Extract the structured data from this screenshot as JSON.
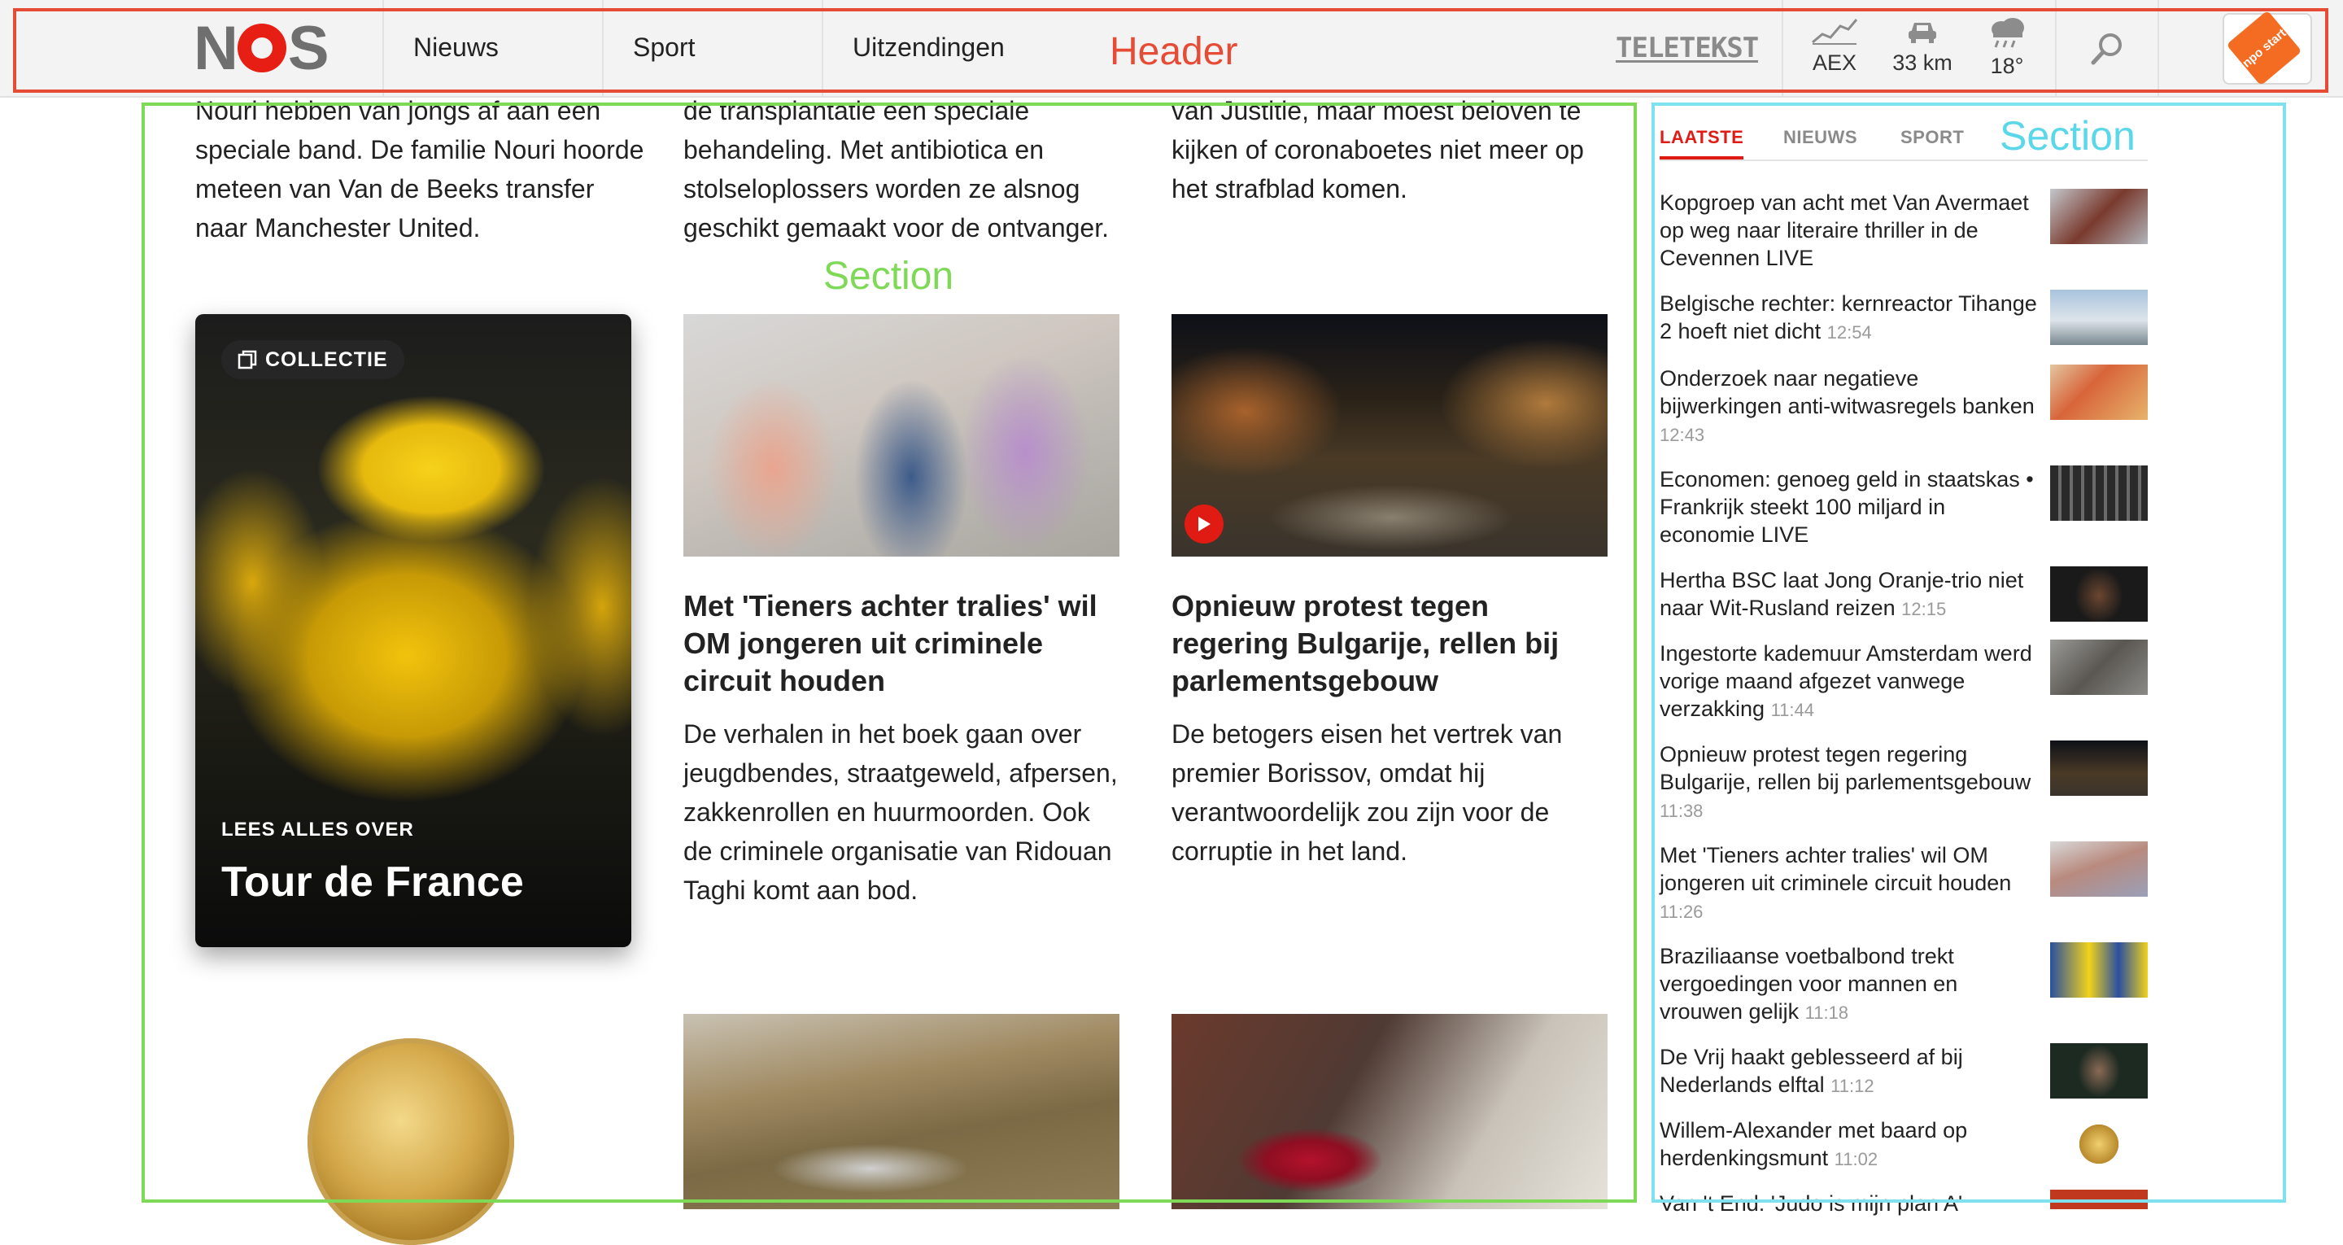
{
  "header": {
    "nav": [
      "Nieuws",
      "Sport",
      "Uitzendingen"
    ],
    "annotation_label": "Header",
    "teletekst": "TELETEKST",
    "widgets": {
      "aex": {
        "label": "AEX",
        "icon": "chart-icon"
      },
      "traffic": {
        "label": "33 km",
        "icon": "car-icon"
      },
      "weather": {
        "label": "18°",
        "icon": "rain-cloud-icon"
      }
    },
    "search_icon": "search-icon",
    "npo_badge": "npo start"
  },
  "annotations": {
    "main_section": "Section",
    "sidebar_section": "Section"
  },
  "intro": [
    "Nouri hebben van jongs af aan een speciale band. De familie Nouri hoorde meteen van Van de Beeks transfer naar Manchester United.",
    "de transplantatie een speciale behandeling. Met antibiotica en stolseloplossers worden ze alsnog geschikt gemaakt voor de ontvanger.",
    "van Justitie, maar moest beloven te kijken of coronaboetes niet meer op het strafblad komen."
  ],
  "collection": {
    "tag": "COLLECTIE",
    "over": "LEES ALLES OVER",
    "title": "Tour de France"
  },
  "articles": [
    {
      "title": "Met 'Tieners achter tralies' wil OM jongeren uit criminele circuit houden",
      "text": "De verhalen in het boek gaan over jeugdbendes, straatgeweld, afpersen, zakkenrollen en huurmoorden. Ook de criminele organisatie van Ridouan Taghi komt aan bod."
    },
    {
      "title": "Opnieuw protest tegen regering Bulgarije, rellen bij parlementsgebouw",
      "text": "De betogers eisen het vertrek van premier Borissov, omdat hij verantwoordelijk zou zijn voor de corruptie in het land."
    }
  ],
  "sidebar": {
    "tabs": [
      "LAATSTE",
      "NIEUWS",
      "SPORT"
    ],
    "active_tab": "LAATSTE",
    "items": [
      {
        "title": "Kopgroep van acht met Van Avermaet op weg naar literaire thriller in de Cevennen LIVE",
        "time": ""
      },
      {
        "title": "Belgische rechter: kernreactor Tihange 2 hoeft niet dicht",
        "time": "12:54"
      },
      {
        "title": "Onderzoek naar negatieve bijwerkingen anti-witwasregels banken",
        "time": "12:43"
      },
      {
        "title": "Economen: genoeg geld in staatskas • Frankrijk steekt 100 miljard in economie LIVE",
        "time": ""
      },
      {
        "title": "Hertha BSC laat Jong Oranje-trio niet naar Wit-Rusland reizen",
        "time": "12:15"
      },
      {
        "title": "Ingestorte kademuur Amsterdam werd vorige maand afgezet vanwege verzakking",
        "time": "11:44"
      },
      {
        "title": "Opnieuw protest tegen regering Bulgarije, rellen bij parlementsgebouw",
        "time": "11:38"
      },
      {
        "title": "Met 'Tieners achter tralies' wil OM jongeren uit criminele circuit houden",
        "time": "11:26"
      },
      {
        "title": "Braziliaanse voetbalbond trekt vergoedingen voor mannen en vrouwen gelijk",
        "time": "11:18"
      },
      {
        "title": "De Vrij haakt geblesseerd af bij Nederlands elftal",
        "time": "11:12"
      },
      {
        "title": "Willem-Alexander met baard op herdenkingsmunt",
        "time": "11:02"
      },
      {
        "title": "Van 't End: 'Judo is mijn plan A'",
        "time": ""
      }
    ]
  },
  "colors": {
    "brand_red": "#e01b14",
    "header_bg": "#f3f3f3"
  }
}
